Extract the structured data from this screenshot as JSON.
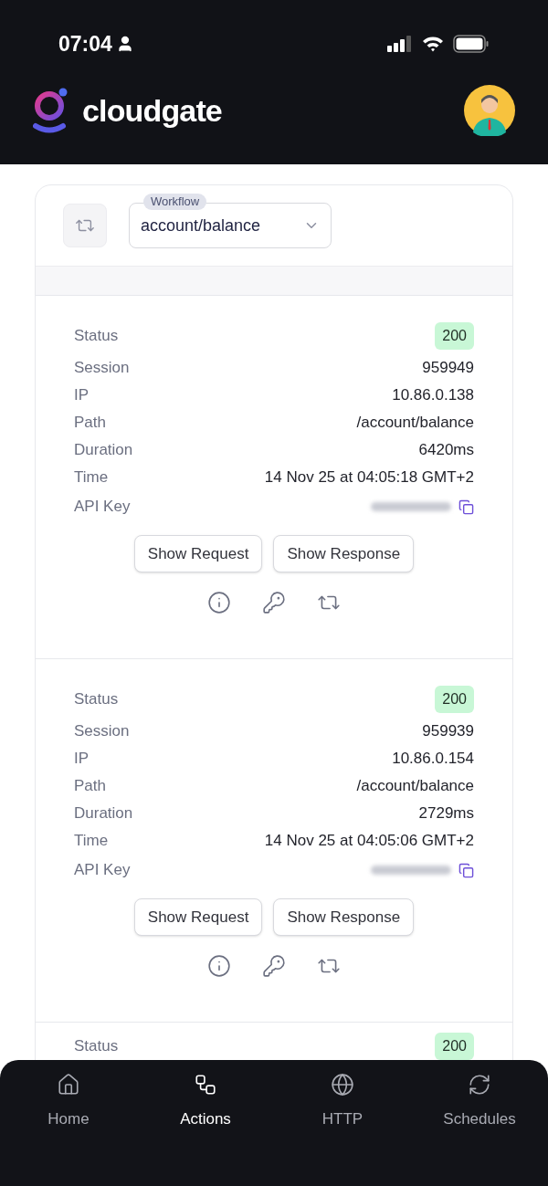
{
  "status_bar": {
    "time": "07:04"
  },
  "header": {
    "brand": "cloudgate"
  },
  "filter": {
    "label": "Workflow",
    "value": "account/balance"
  },
  "entries": [
    {
      "rows": [
        {
          "label": "Status",
          "value": "200",
          "kind": "badge"
        },
        {
          "label": "Session",
          "value": "959949",
          "kind": "text"
        },
        {
          "label": "IP",
          "value": "10.86.0.138",
          "kind": "text"
        },
        {
          "label": "Path",
          "value": "/account/balance",
          "kind": "text"
        },
        {
          "label": "Duration",
          "value": "6420ms",
          "kind": "text"
        },
        {
          "label": "Time",
          "value": "14 Nov 25 at 04:05:18 GMT+2",
          "kind": "text"
        },
        {
          "label": "API Key",
          "kind": "redacted"
        }
      ],
      "buttons": [
        "Show Request",
        "Show Response"
      ]
    },
    {
      "rows": [
        {
          "label": "Status",
          "value": "200",
          "kind": "badge"
        },
        {
          "label": "Session",
          "value": "959939",
          "kind": "text"
        },
        {
          "label": "IP",
          "value": "10.86.0.154",
          "kind": "text"
        },
        {
          "label": "Path",
          "value": "/account/balance",
          "kind": "text"
        },
        {
          "label": "Duration",
          "value": "2729ms",
          "kind": "text"
        },
        {
          "label": "Time",
          "value": "14 Nov 25 at 04:05:06 GMT+2",
          "kind": "text"
        },
        {
          "label": "API Key",
          "kind": "redacted"
        }
      ],
      "buttons": [
        "Show Request",
        "Show Response"
      ]
    },
    {
      "rows": [
        {
          "label": "Status",
          "value": "200",
          "kind": "badge"
        }
      ]
    }
  ],
  "nav": [
    {
      "label": "Home",
      "selected": false
    },
    {
      "label": "Actions",
      "selected": true
    },
    {
      "label": "HTTP",
      "selected": false
    },
    {
      "label": "Schedules",
      "selected": false
    }
  ]
}
